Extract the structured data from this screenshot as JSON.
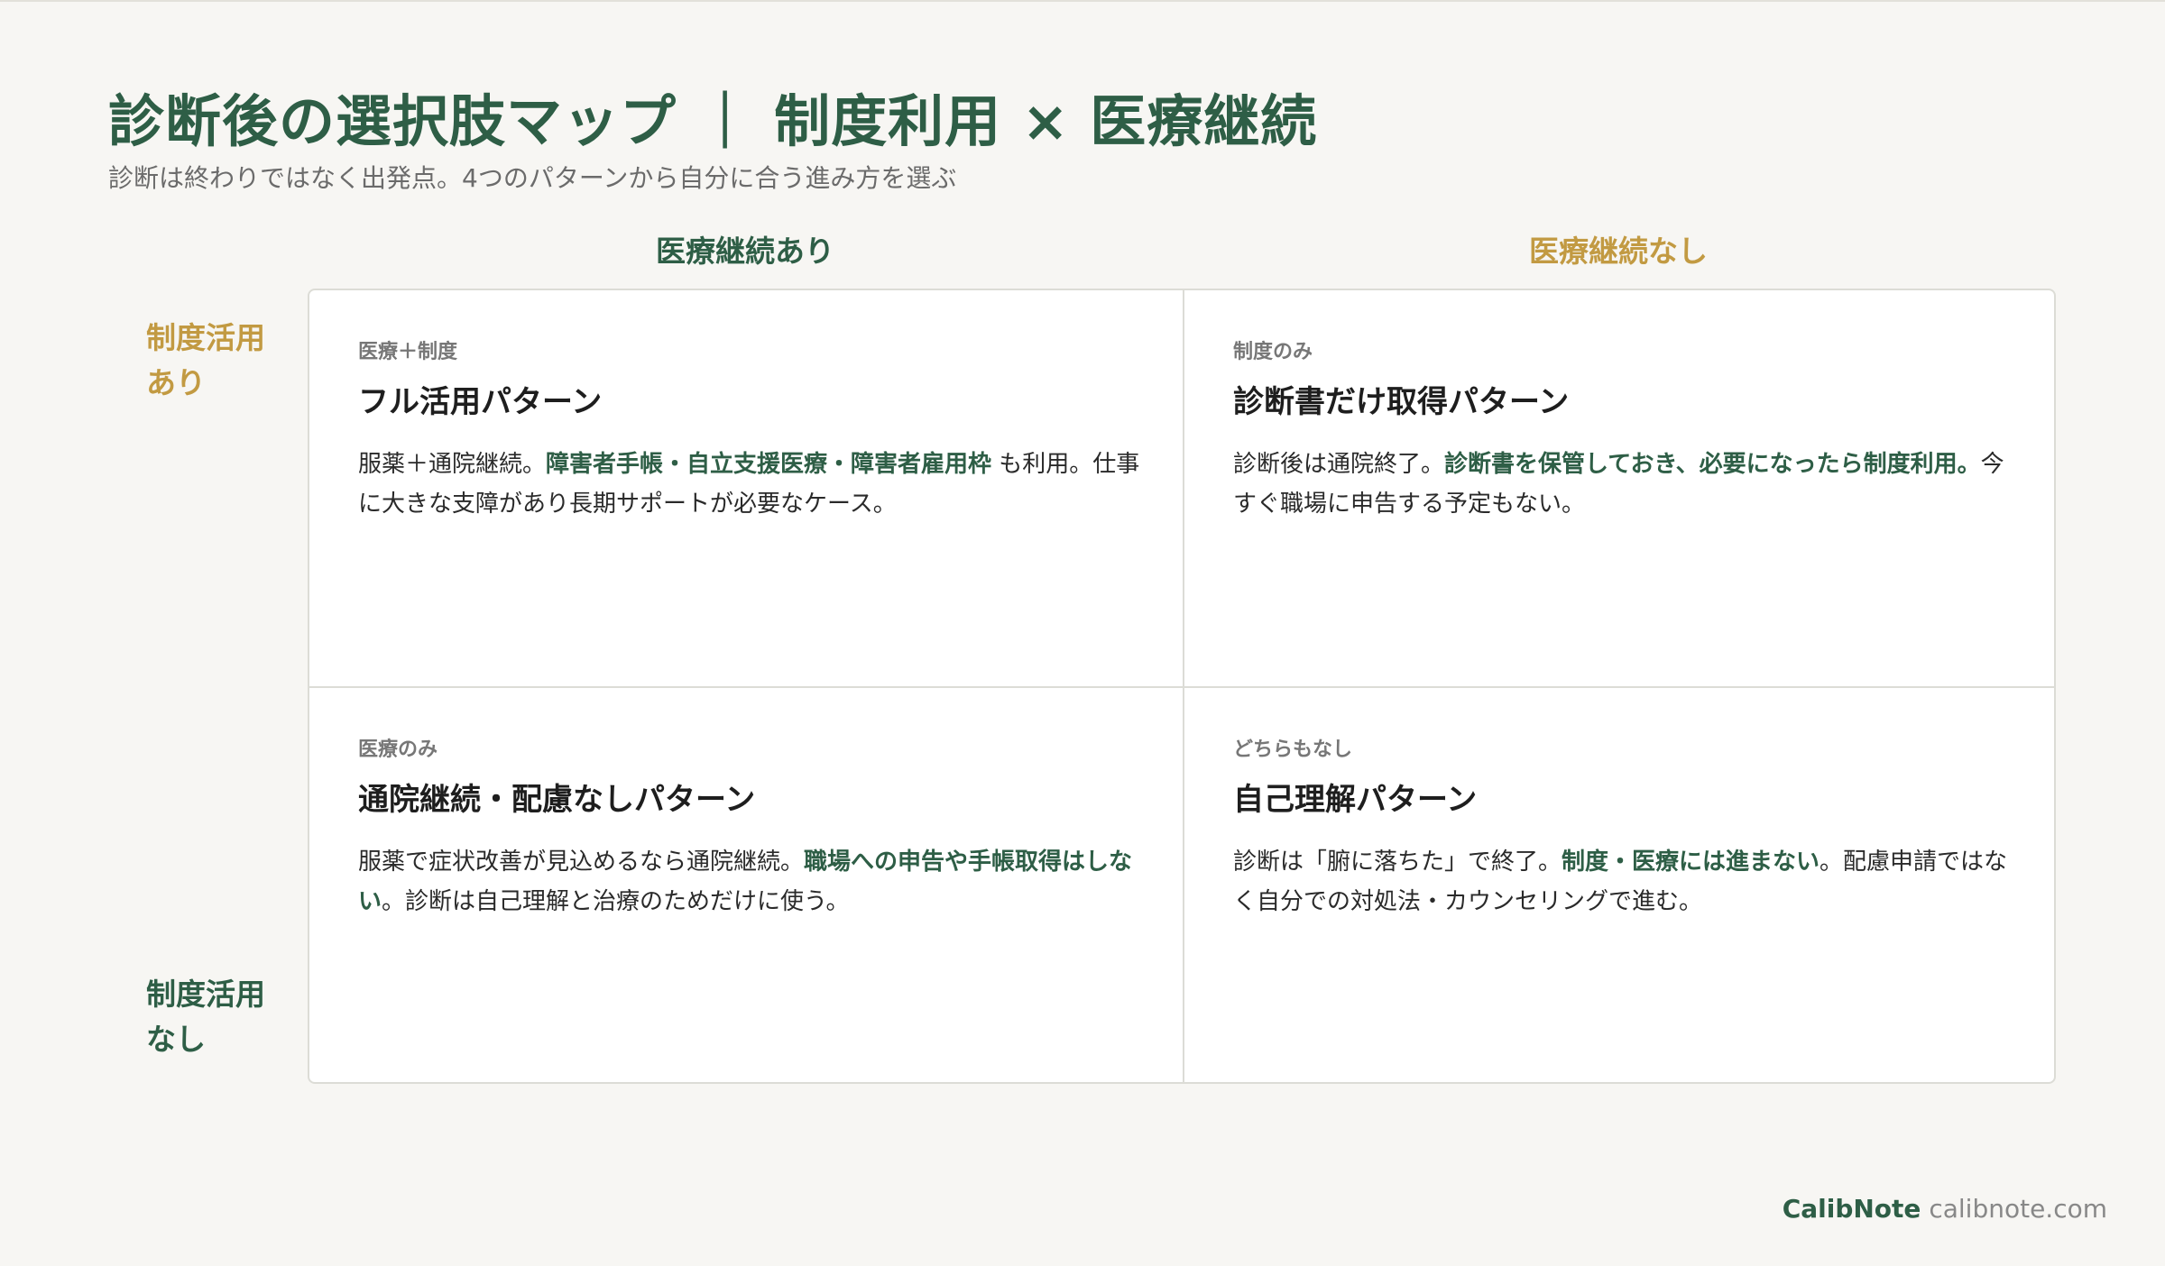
{
  "title": "診断後の選択肢マップ ｜ 制度利用 × 医療継続",
  "subtitle": "診断は終わりではなく出発点。4つのパターンから自分に合う進み方を選ぶ",
  "colors": {
    "primary": "#2e5e46",
    "accent": "#c29a42",
    "muted": "#777777"
  },
  "columns": {
    "left": "医療継続あり",
    "right": "医療継続なし"
  },
  "rows": {
    "top": [
      "制度活用",
      "あり"
    ],
    "bottom": [
      "制度活用",
      "なし"
    ]
  },
  "quadrants": {
    "top_left": {
      "tag": "医療＋制度",
      "title": "フル活用パターン",
      "body_1": "服薬＋通院継続。",
      "highlight_1": "障害者手帳・自立支援医療・障害者雇用枠",
      "body_2": " も利用。仕事に大きな支障があり長期サポートが必要なケース。"
    },
    "top_right": {
      "tag": "制度のみ",
      "title": "診断書だけ取得パターン",
      "body_1": "診断後は通院終了。",
      "highlight_1": "診断書を保管しておき、必要になったら制度利用。",
      "body_2": "今すぐ職場に申告する予定もない。"
    },
    "bottom_left": {
      "tag": "医療のみ",
      "title": "通院継続・配慮なしパターン",
      "body_1": "服薬で症状改善が見込めるなら通院継続。",
      "highlight_1": "職場への申告や手帳取得はしない",
      "body_2": "。診断は自己理解と治療のためだけに使う。"
    },
    "bottom_right": {
      "tag": "どちらもなし",
      "title": "自己理解パターン",
      "body_1": "診断は「腑に落ちた」で終了。",
      "highlight_1": "制度・医療には進まない",
      "body_2": "。配慮申請ではなく自分での対処法・カウンセリングで進む。"
    }
  },
  "footer": {
    "brand": "CalibNote",
    "domain": "calibnote.com"
  }
}
